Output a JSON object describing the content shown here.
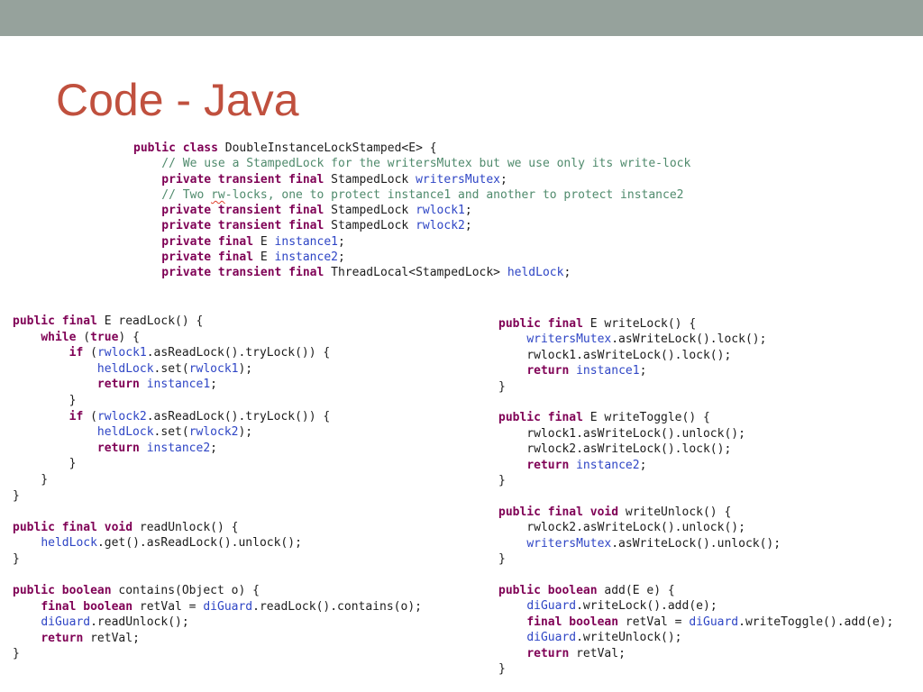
{
  "header": {
    "bar_color": "#96a29c"
  },
  "title": "Code - Java",
  "colors": {
    "kw": "#7f0055",
    "id": "#2e45c5",
    "cmt": "#4f8a6c",
    "plain": "#1c1c1c",
    "err": "#e0402f",
    "titlec": "#c0503e",
    "bar": "#96a29c"
  },
  "code_blocks": {
    "class_declaration": {
      "lines": [
        [
          [
            "kw",
            "public class "
          ],
          [
            "p",
            "DoubleInstanceLockStamped<E> {"
          ]
        ],
        [
          [
            "c",
            "    // We use a StampedLock for the writersMutex but we use only its write-lock"
          ]
        ],
        [
          [
            "kw",
            "    private transient final "
          ],
          [
            "p",
            "StampedLock "
          ],
          [
            "id",
            "writersMutex"
          ],
          [
            "p",
            ";"
          ]
        ],
        [
          [
            "c",
            "    // Two "
          ],
          [
            "ce",
            "rw"
          ],
          [
            "c",
            "-locks, one to protect instance1 and another to protect instance2"
          ]
        ],
        [
          [
            "kw",
            "    private transient final "
          ],
          [
            "p",
            "StampedLock "
          ],
          [
            "id",
            "rwlock1"
          ],
          [
            "p",
            ";"
          ]
        ],
        [
          [
            "kw",
            "    private transient final "
          ],
          [
            "p",
            "StampedLock "
          ],
          [
            "id",
            "rwlock2"
          ],
          [
            "p",
            ";"
          ]
        ],
        [
          [
            "kw",
            "    private final "
          ],
          [
            "p",
            "E "
          ],
          [
            "id",
            "instance1"
          ],
          [
            "p",
            ";"
          ]
        ],
        [
          [
            "kw",
            "    private final "
          ],
          [
            "p",
            "E "
          ],
          [
            "id",
            "instance2"
          ],
          [
            "p",
            ";"
          ]
        ],
        [
          [
            "kw",
            "    private transient final "
          ],
          [
            "p",
            "ThreadLocal<StampedLock> "
          ],
          [
            "id",
            "heldLock"
          ],
          [
            "p",
            ";"
          ]
        ]
      ]
    },
    "left_column": {
      "lines": [
        [
          [
            "kw",
            "public final "
          ],
          [
            "p",
            "E readLock() {"
          ]
        ],
        [
          [
            "p",
            "    "
          ],
          [
            "kw",
            "while "
          ],
          [
            "p",
            "("
          ],
          [
            "kw",
            "true"
          ],
          [
            "p",
            ") {"
          ]
        ],
        [
          [
            "p",
            "        "
          ],
          [
            "kw",
            "if "
          ],
          [
            "p",
            "("
          ],
          [
            "id",
            "rwlock1"
          ],
          [
            "p",
            ".asReadLock().tryLock()) {"
          ]
        ],
        [
          [
            "p",
            "            "
          ],
          [
            "id",
            "heldLock"
          ],
          [
            "p",
            ".set("
          ],
          [
            "id",
            "rwlock1"
          ],
          [
            "p",
            ");"
          ]
        ],
        [
          [
            "p",
            "            "
          ],
          [
            "kw",
            "return "
          ],
          [
            "id",
            "instance1"
          ],
          [
            "p",
            ";"
          ]
        ],
        [
          [
            "p",
            "        }"
          ]
        ],
        [
          [
            "p",
            "        "
          ],
          [
            "kw",
            "if "
          ],
          [
            "p",
            "("
          ],
          [
            "id",
            "rwlock2"
          ],
          [
            "p",
            ".asReadLock().tryLock()) {"
          ]
        ],
        [
          [
            "p",
            "            "
          ],
          [
            "id",
            "heldLock"
          ],
          [
            "p",
            ".set("
          ],
          [
            "id",
            "rwlock2"
          ],
          [
            "p",
            ");"
          ]
        ],
        [
          [
            "p",
            "            "
          ],
          [
            "kw",
            "return "
          ],
          [
            "id",
            "instance2"
          ],
          [
            "p",
            ";"
          ]
        ],
        [
          [
            "p",
            "        }"
          ]
        ],
        [
          [
            "p",
            "    }"
          ]
        ],
        [
          [
            "p",
            "}"
          ]
        ],
        [],
        [
          [
            "kw",
            "public final void "
          ],
          [
            "p",
            "readUnlock() {"
          ]
        ],
        [
          [
            "p",
            "    "
          ],
          [
            "id",
            "heldLock"
          ],
          [
            "p",
            ".get().asReadLock().unlock();"
          ]
        ],
        [
          [
            "p",
            "}"
          ]
        ],
        [],
        [
          [
            "kw",
            "public boolean "
          ],
          [
            "p",
            "contains(Object o) {"
          ]
        ],
        [
          [
            "p",
            "    "
          ],
          [
            "kw",
            "final boolean "
          ],
          [
            "p",
            "retVal = "
          ],
          [
            "id",
            "diGuard"
          ],
          [
            "p",
            ".readLock().contains(o);"
          ]
        ],
        [
          [
            "p",
            "    "
          ],
          [
            "id",
            "diGuard"
          ],
          [
            "p",
            ".readUnlock();"
          ]
        ],
        [
          [
            "p",
            "    "
          ],
          [
            "kw",
            "return "
          ],
          [
            "p",
            "retVal;"
          ]
        ],
        [
          [
            "p",
            "}"
          ]
        ]
      ]
    },
    "right_column": {
      "lines": [
        [
          [
            "kw",
            "public final "
          ],
          [
            "p",
            "E writeLock() {"
          ]
        ],
        [
          [
            "p",
            "    "
          ],
          [
            "id",
            "writersMutex"
          ],
          [
            "p",
            ".asWriteLock().lock();"
          ]
        ],
        [
          [
            "p",
            "    rwlock1.asWriteLock().lock();"
          ]
        ],
        [
          [
            "p",
            "    "
          ],
          [
            "kw",
            "return "
          ],
          [
            "id",
            "instance1"
          ],
          [
            "p",
            ";"
          ]
        ],
        [
          [
            "p",
            "}"
          ]
        ],
        [],
        [
          [
            "kw",
            "public final "
          ],
          [
            "p",
            "E writeToggle() {"
          ]
        ],
        [
          [
            "p",
            "    rwlock1.asWriteLock().unlock();"
          ]
        ],
        [
          [
            "p",
            "    rwlock2.asWriteLock().lock();"
          ]
        ],
        [
          [
            "p",
            "    "
          ],
          [
            "kw",
            "return "
          ],
          [
            "id",
            "instance2"
          ],
          [
            "p",
            ";"
          ]
        ],
        [
          [
            "p",
            "}"
          ]
        ],
        [],
        [
          [
            "kw",
            "public final void "
          ],
          [
            "p",
            "writeUnlock() {"
          ]
        ],
        [
          [
            "p",
            "    rwlock2.asWriteLock().unlock();"
          ]
        ],
        [
          [
            "p",
            "    "
          ],
          [
            "id",
            "writersMutex"
          ],
          [
            "p",
            ".asWriteLock().unlock();"
          ]
        ],
        [
          [
            "p",
            "}"
          ]
        ],
        [],
        [
          [
            "kw",
            "public boolean "
          ],
          [
            "p",
            "add(E e) {"
          ]
        ],
        [
          [
            "p",
            "    "
          ],
          [
            "id",
            "diGuard"
          ],
          [
            "p",
            ".writeLock().add(e);"
          ]
        ],
        [
          [
            "p",
            "    "
          ],
          [
            "kw",
            "final boolean "
          ],
          [
            "p",
            "retVal = "
          ],
          [
            "id",
            "diGuard"
          ],
          [
            "p",
            ".writeToggle().add(e);"
          ]
        ],
        [
          [
            "p",
            "    "
          ],
          [
            "id",
            "diGuard"
          ],
          [
            "p",
            ".writeUnlock();"
          ]
        ],
        [
          [
            "p",
            "    "
          ],
          [
            "kw",
            "return "
          ],
          [
            "p",
            "retVal;"
          ]
        ],
        [
          [
            "p",
            "}"
          ]
        ]
      ]
    }
  }
}
